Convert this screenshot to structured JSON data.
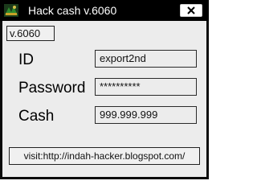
{
  "window": {
    "title": "Hack cash v.6060"
  },
  "version_label": "v.6060",
  "form": {
    "id_label": "ID",
    "id_value": "export2nd",
    "password_label": "Password",
    "password_value": "**********",
    "cash_label": "Cash",
    "cash_value": "999.999.999"
  },
  "footer": {
    "visit_text": "visit:http://indah-hacker.blogspot.com/"
  },
  "icons": {
    "app": "app-logo-icon",
    "close": "close-icon"
  }
}
